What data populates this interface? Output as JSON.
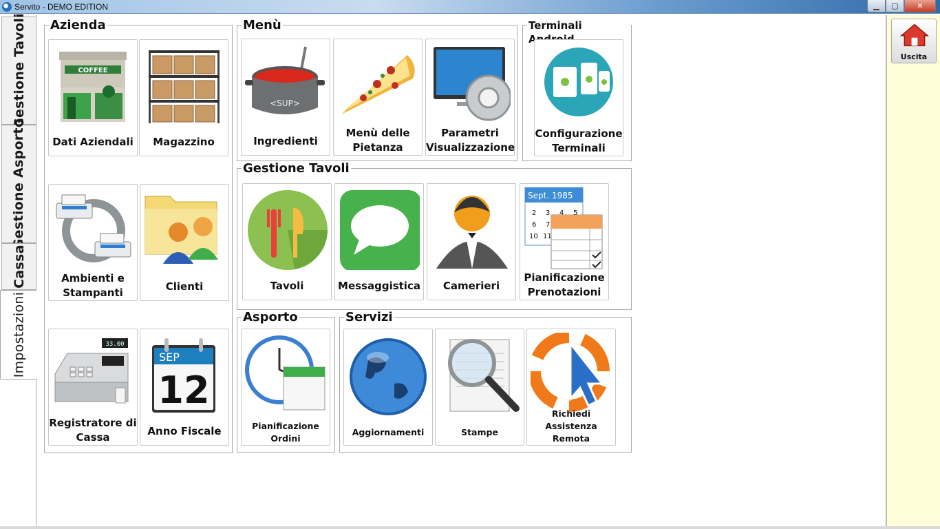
{
  "window": {
    "title": "Servito - DEMO EDITION"
  },
  "tabs": [
    {
      "label": "Gestione Tavoli"
    },
    {
      "label": "Gestione Asporto"
    },
    {
      "label": "Cassa"
    },
    {
      "label": "Impostazioni"
    }
  ],
  "groups": {
    "azienda": {
      "title": "Azienda",
      "tiles": [
        {
          "label": "Dati Aziendali"
        },
        {
          "label": "Magazzino"
        },
        {
          "label": "Ambienti e Stampanti"
        },
        {
          "label": "Clienti"
        },
        {
          "label": "Registratore di Cassa"
        },
        {
          "label": "Anno Fiscale"
        }
      ]
    },
    "menu": {
      "title": "Menù",
      "tiles": [
        {
          "label": "Ingredienti"
        },
        {
          "label": "Menù delle Pietanza"
        },
        {
          "label": "Parametri Visualizzazione"
        }
      ]
    },
    "android": {
      "title": "Terminali Android",
      "tiles": [
        {
          "label": "Configurazione Terminali"
        }
      ]
    },
    "tavoli": {
      "title": "Gestione Tavoli",
      "tiles": [
        {
          "label": "Tavoli"
        },
        {
          "label": "Messaggistica"
        },
        {
          "label": "Camerieri"
        },
        {
          "label": "Pianificazione Prenotazioni"
        }
      ]
    },
    "asporto": {
      "title": "Asporto",
      "tiles": [
        {
          "label": "Pianificazione Ordini"
        }
      ]
    },
    "servizi": {
      "title": "Servizi",
      "tiles": [
        {
          "label": "Aggiornamenti"
        },
        {
          "label": "Stampe"
        },
        {
          "label": "Richiedi Assistenza Remota"
        }
      ]
    }
  },
  "icon_text": {
    "coffee_sign": "COFFEE",
    "pot_label": "<SUP>",
    "calendar_month": "SEP",
    "calendar_day": "12",
    "cash_display": "33.00",
    "booking_header": "Sept.  1985",
    "booking_days": [
      "2",
      "3",
      "4",
      "5",
      "6",
      "7",
      "10",
      "11"
    ]
  },
  "exit": {
    "label": "Uscita"
  }
}
